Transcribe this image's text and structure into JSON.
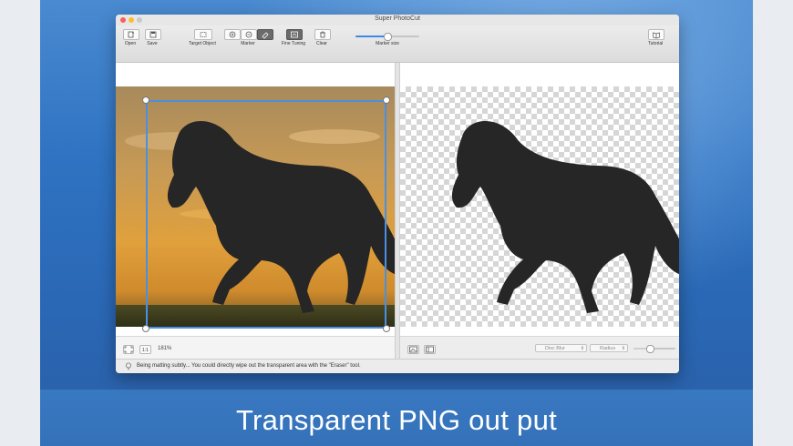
{
  "window": {
    "title": "Super PhotoCut"
  },
  "toolbar": {
    "open": "Open",
    "save": "Save",
    "target_object": "Target Object",
    "marker": "Marker",
    "fine_tuning": "Fine Tuning",
    "clear": "Clear",
    "marker_size": "Marker size",
    "marker_size_value": 0.5,
    "tutorial": "Tutorial"
  },
  "left_panel": {
    "zoom_level": "181%",
    "ratio_button": "1:1"
  },
  "right_panel": {
    "blur_type": "Disc Blur",
    "radius_label": "Radius",
    "radius_value": 0.4
  },
  "status": {
    "message": "Being matting subtly... You could directly wipe out the transparent area with the \"Eraser\" tool."
  },
  "caption": "Transparent PNG out put",
  "colors": {
    "accent": "#3d8ae6",
    "selection": "#4a90e2",
    "background_blue": "#2f73c2"
  }
}
